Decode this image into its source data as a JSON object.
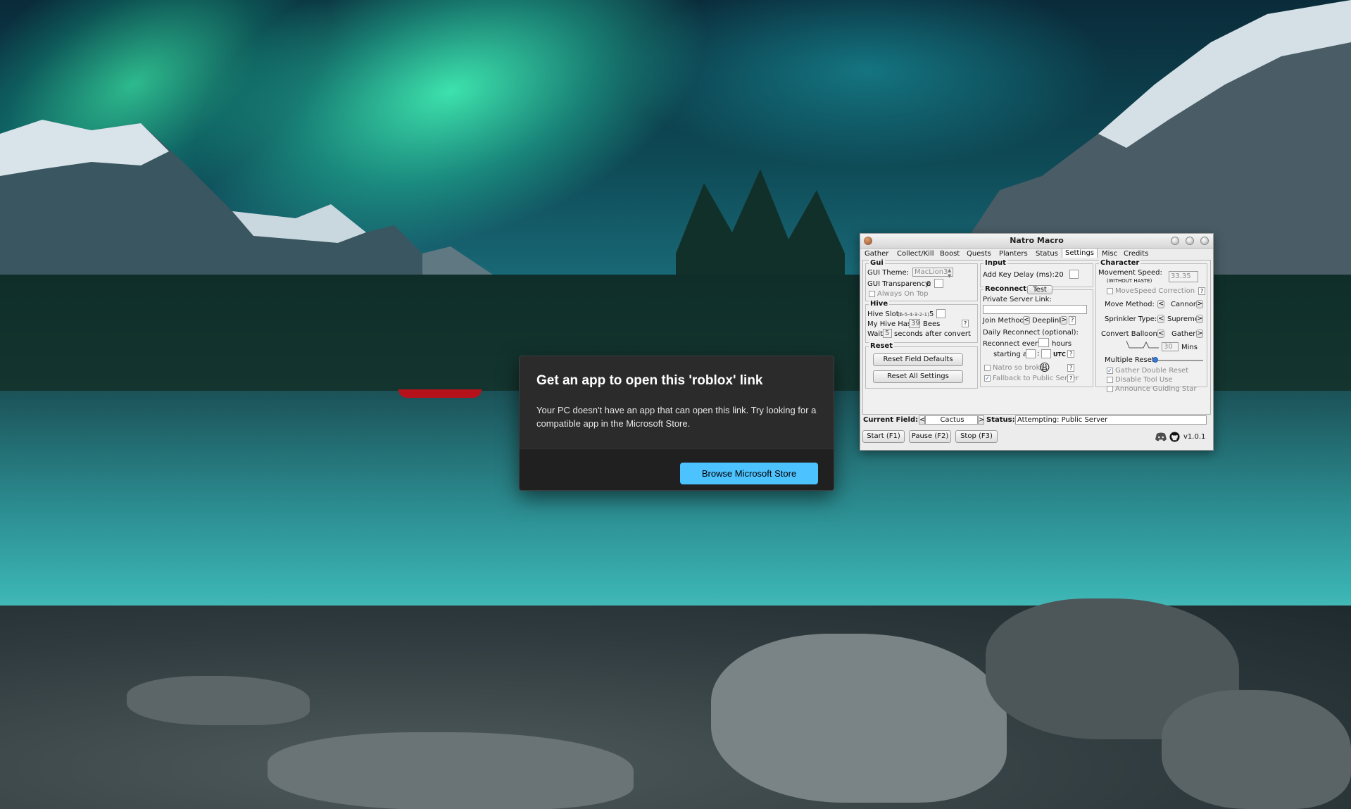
{
  "dialog": {
    "title": "Get an app to open this 'roblox' link",
    "body": "Your PC doesn't have an app that can open this link. Try looking for a compatible app in the Microsoft Store.",
    "browse_label": "Browse Microsoft Store"
  },
  "macro": {
    "title": "Natro Macro",
    "tabs": [
      "Gather",
      "Collect/Kill",
      "Boost",
      "Quests",
      "Planters",
      "Status",
      "Settings",
      "Misc",
      "Credits"
    ],
    "active_tab": "Settings",
    "gui": {
      "title": "Gui",
      "theme_label": "GUI Theme:",
      "theme_value": "MacLion3",
      "transparency_label": "GUI Transparency:",
      "transparency_value": "0",
      "always_on_top": "Always On Top"
    },
    "hive": {
      "title": "Hive",
      "slot_label": "Hive Slot:",
      "slot_hint": "(6-5-4-3-2-1)",
      "slot_value": "5",
      "has_label": "My Hive Has:",
      "bees_value": "39",
      "bees_label": "Bees",
      "wait_label": "Wait",
      "wait_value": "5",
      "wait_suffix": "seconds after convert",
      "help": "?"
    },
    "reset": {
      "title": "Reset",
      "field_defaults": "Reset Field Defaults",
      "all_settings": "Reset All Settings"
    },
    "input": {
      "title": "Input",
      "key_delay_label": "Add Key Delay (ms):",
      "key_delay_value": "20"
    },
    "reconnect": {
      "title": "Reconnect",
      "test_label": "Test",
      "server_link_label": "Private Server Link:",
      "join_method_label": "Join Method:",
      "join_method_value": "Deeplink",
      "daily_label": "Daily Reconnect (optional):",
      "every_label": "Reconnect every",
      "hours_label": "hours",
      "starting_label": "starting at",
      "utc_label": "UTC",
      "natro_broke": "Natro so broke",
      "fallback": "Fallback to Public Server",
      "emoji": "😩"
    },
    "character": {
      "title": "Character",
      "speed_label": "Movement Speed:",
      "speed_sub": "(WITHOUT HASTE)",
      "speed_value": "33.35",
      "speed_correction": "MoveSpeed Correction",
      "move_method_label": "Move Method:",
      "move_method_value": "Cannon",
      "sprinkler_label": "Sprinkler Type:",
      "sprinkler_value": "Supreme",
      "balloon_label": "Convert Balloon:",
      "balloon_value": "Gather",
      "mins_value": "30",
      "mins_label": "Mins",
      "multiple_reset_label": "Multiple Reset:",
      "gather_double_reset": "Gather Double Reset",
      "disable_tool_use": "Disable Tool Use",
      "announce_guiding_star": "Announce Guiding Star"
    },
    "statusbar": {
      "field_label": "Current Field:",
      "field_value": "Cactus",
      "status_label": "Status:",
      "status_value": "Attempting: Public Server"
    },
    "controls": {
      "start": "Start (F1)",
      "pause": "Pause (F2)",
      "stop": "Stop (F3)",
      "version": "v1.0.1"
    },
    "symbols": {
      "left": "<",
      "right": ">",
      "help": "?",
      "check": "✓",
      "colon": ":"
    },
    "accent_color": "#3b78d0"
  }
}
